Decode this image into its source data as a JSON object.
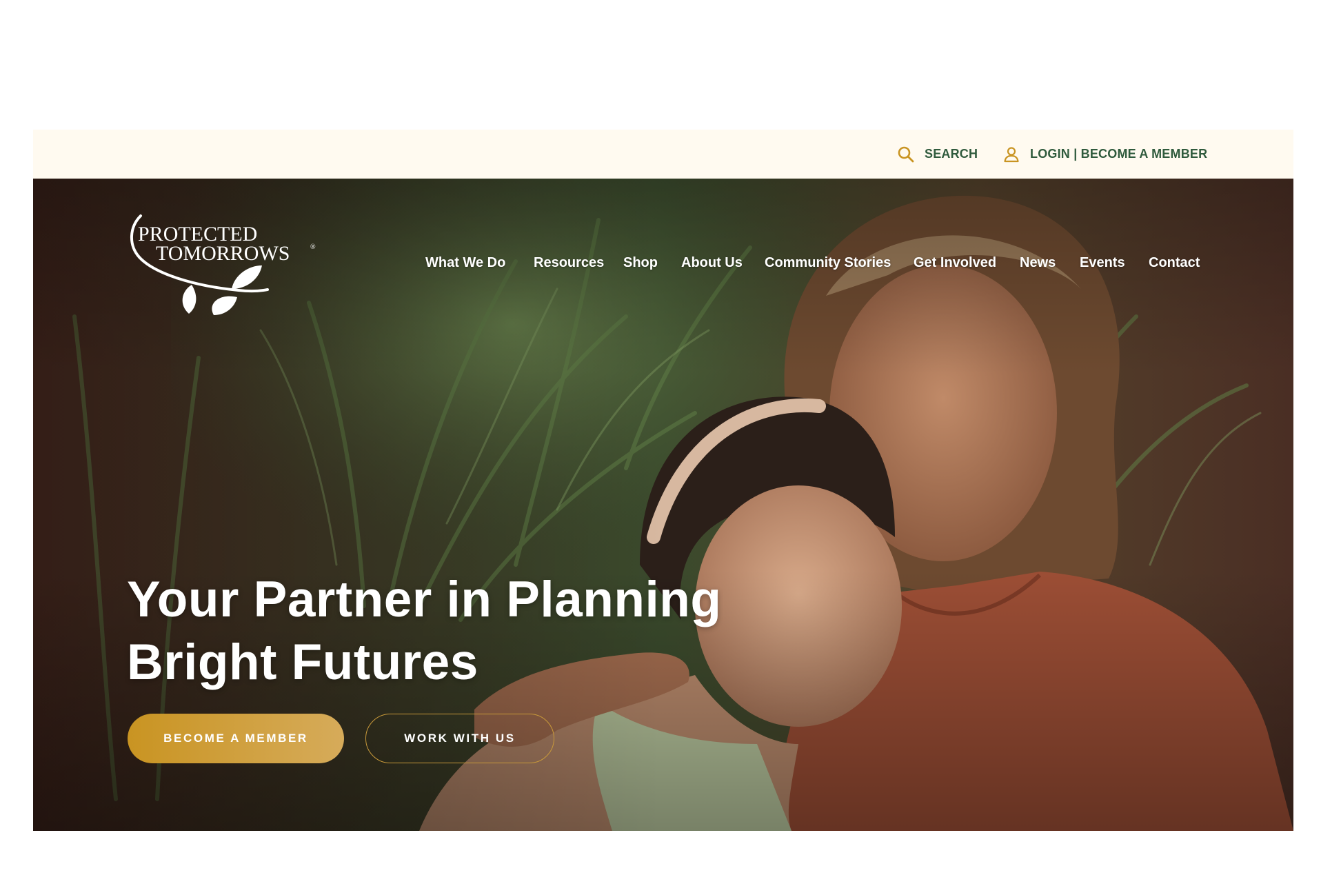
{
  "utility_bar": {
    "search_label": "SEARCH",
    "login_label": "LOGIN | BECOME A MEMBER",
    "search_icon": "magnifier-icon",
    "account_icon": "user-icon"
  },
  "brand": {
    "line1": "PROTECTED",
    "line2": "TOMORROWS",
    "registered": "®"
  },
  "nav": {
    "items": [
      {
        "label": "What We Do"
      },
      {
        "label": "Resources"
      },
      {
        "label": "Shop"
      },
      {
        "label": "About Us"
      },
      {
        "label": "Community Stories"
      },
      {
        "label": "Get Involved"
      },
      {
        "label": "News"
      },
      {
        "label": "Events"
      },
      {
        "label": "Contact"
      }
    ]
  },
  "hero": {
    "headline_line1": "Your Partner in Planning",
    "headline_line2": "Bright Futures",
    "primary_button": "BECOME A MEMBER",
    "secondary_button": "WORK WITH US"
  },
  "colors": {
    "utility_bg": "#fffaf0",
    "utility_text": "#2f5a3c",
    "accent_gold": "#c99422",
    "accent_gold_light": "#d6ab5a",
    "hero_text": "#ffffff"
  }
}
